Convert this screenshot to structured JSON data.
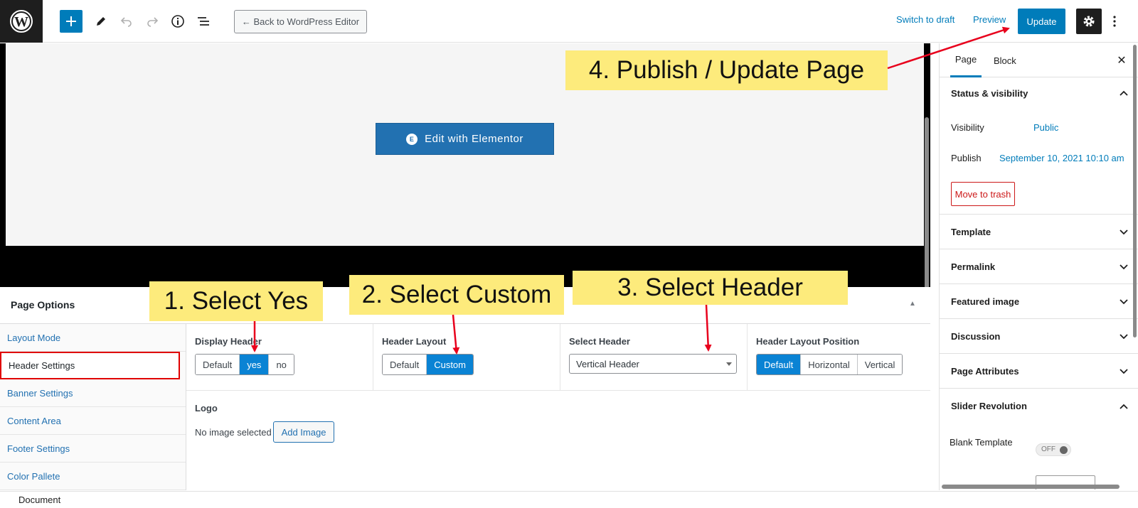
{
  "topbar": {
    "back_label": "← Back to WordPress Editor",
    "switch_draft": "Switch to draft",
    "preview": "Preview",
    "update": "Update"
  },
  "canvas": {
    "elementor_button": "Edit with Elementor",
    "elementor_logo": "E"
  },
  "page_options": {
    "title": "Page Options",
    "nav": [
      {
        "label": "Layout Mode"
      },
      {
        "label": "Header Settings"
      },
      {
        "label": "Banner Settings"
      },
      {
        "label": "Content Area"
      },
      {
        "label": "Footer Settings"
      },
      {
        "label": "Color Pallete"
      }
    ],
    "display_header": {
      "label": "Display Header",
      "options": [
        "Default",
        "yes",
        "no"
      ],
      "selected": "yes"
    },
    "header_layout": {
      "label": "Header Layout",
      "options": [
        "Default",
        "Custom"
      ],
      "selected": "Custom"
    },
    "select_header": {
      "label": "Select Header",
      "value": "Vertical Header"
    },
    "header_layout_position": {
      "label": "Header Layout Position",
      "options": [
        "Default",
        "Horizontal",
        "Vertical"
      ],
      "selected": "Default"
    },
    "logo": {
      "label": "Logo",
      "status": "No image selected",
      "add_button": "Add Image"
    }
  },
  "sidebar": {
    "tabs": [
      "Page",
      "Block"
    ],
    "status_visibility": {
      "title": "Status & visibility",
      "visibility_label": "Visibility",
      "visibility_value": "Public",
      "publish_label": "Publish",
      "publish_value": "September 10, 2021 10:10 am",
      "trash": "Move to trash"
    },
    "panels": [
      "Template",
      "Permalink",
      "Featured image",
      "Discussion",
      "Page Attributes"
    ],
    "slider_revolution": {
      "title": "Slider Revolution",
      "blank_template_label": "Blank Template",
      "toggle_state": "OFF"
    }
  },
  "footer": {
    "breadcrumb": "Document"
  },
  "annotations": {
    "step1": "1. Select Yes",
    "step2": "2. Select Custom",
    "step3": "3. Select Header",
    "step4": "4. Publish / Update Page"
  },
  "colors": {
    "accent": "#007cba",
    "callout": "#fdeb7c",
    "arrow": "#e8001c",
    "active_outline": "#e00000"
  }
}
